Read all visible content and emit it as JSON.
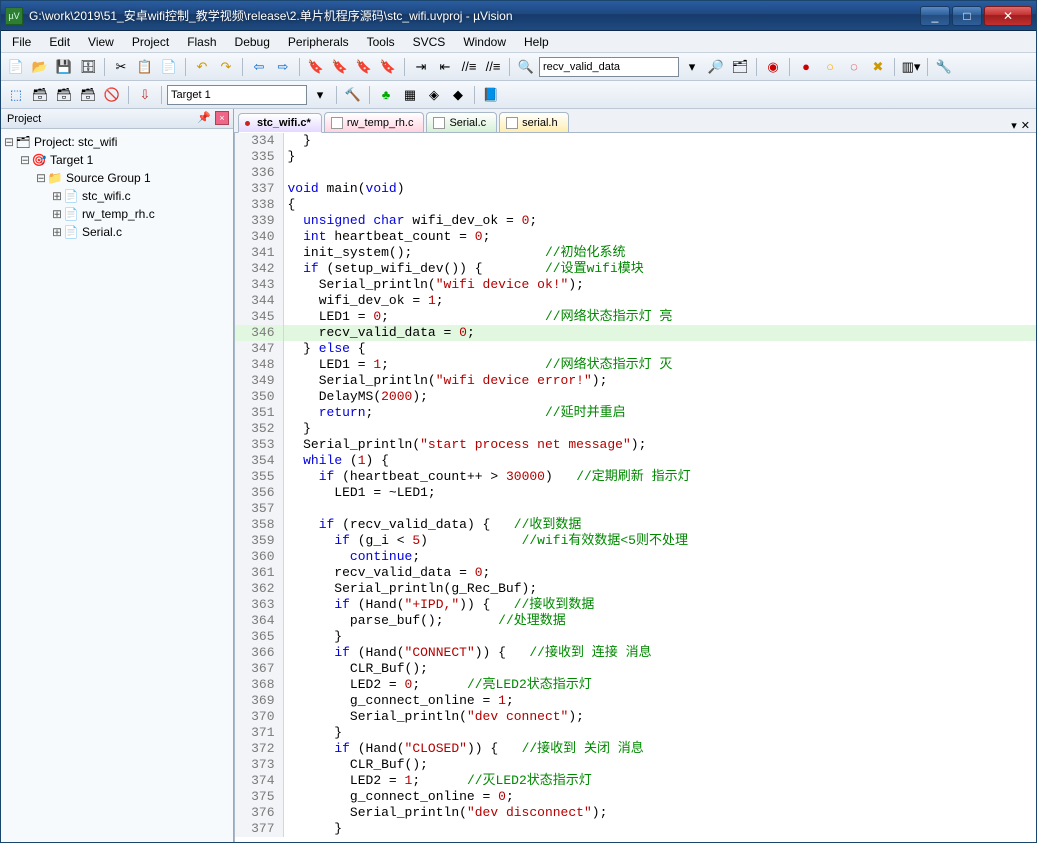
{
  "window": {
    "title": "G:\\work\\2019\\51_安卓wifi控制_教学视频\\release\\2.单片机程序源码\\stc_wifi.uvproj - µVision",
    "app_icon_label": "µV"
  },
  "menus": [
    "File",
    "Edit",
    "View",
    "Project",
    "Flash",
    "Debug",
    "Peripherals",
    "Tools",
    "SVCS",
    "Window",
    "Help"
  ],
  "toolbar1": {
    "search_value": "recv_valid_data"
  },
  "toolbar2": {
    "target_value": "Target 1"
  },
  "project_pane": {
    "title": "Project",
    "root_label": "Project: stc_wifi",
    "target_label": "Target 1",
    "group_label": "Source Group 1",
    "files": [
      "stc_wifi.c",
      "rw_temp_rh.c",
      "Serial.c"
    ]
  },
  "tabs": [
    {
      "label": "stc_wifi.c*",
      "cls": "lav"
    },
    {
      "label": "rw_temp_rh.c",
      "cls": "pink"
    },
    {
      "label": "Serial.c",
      "cls": "green"
    },
    {
      "label": "serial.h",
      "cls": "yell"
    }
  ],
  "highlight_line": 346,
  "code": [
    {
      "n": 334,
      "t": [
        [
          "",
          "  }"
        ]
      ]
    },
    {
      "n": 335,
      "t": [
        [
          "",
          "}"
        ]
      ]
    },
    {
      "n": 336,
      "t": [
        [
          "",
          ""
        ]
      ]
    },
    {
      "n": 337,
      "t": [
        [
          "ty",
          "void"
        ],
        [
          "",
          " main("
        ],
        [
          "ty",
          "void"
        ],
        [
          "",
          ")"
        ]
      ]
    },
    {
      "n": 338,
      "t": [
        [
          "",
          "{"
        ]
      ]
    },
    {
      "n": 339,
      "t": [
        [
          "",
          "  "
        ],
        [
          "ty",
          "unsigned char"
        ],
        [
          "",
          " wifi_dev_ok = "
        ],
        [
          "num",
          "0"
        ],
        [
          "",
          ";"
        ]
      ]
    },
    {
      "n": 340,
      "t": [
        [
          "",
          "  "
        ],
        [
          "ty",
          "int"
        ],
        [
          "",
          " heartbeat_count = "
        ],
        [
          "num",
          "0"
        ],
        [
          "",
          ";"
        ]
      ]
    },
    {
      "n": 341,
      "t": [
        [
          "",
          "  init_system();                 "
        ],
        [
          "cm",
          "//初始化系统"
        ]
      ]
    },
    {
      "n": 342,
      "t": [
        [
          "",
          "  "
        ],
        [
          "kw",
          "if"
        ],
        [
          "",
          " (setup_wifi_dev()) {        "
        ],
        [
          "cm",
          "//设置wifi模块"
        ]
      ]
    },
    {
      "n": 343,
      "t": [
        [
          "",
          "    Serial_println("
        ],
        [
          "str",
          "\"wifi device ok!\""
        ],
        [
          "",
          ");"
        ]
      ]
    },
    {
      "n": 344,
      "t": [
        [
          "",
          "    wifi_dev_ok = "
        ],
        [
          "num",
          "1"
        ],
        [
          "",
          ";"
        ]
      ]
    },
    {
      "n": 345,
      "t": [
        [
          "",
          "    LED1 = "
        ],
        [
          "num",
          "0"
        ],
        [
          "",
          ";                    "
        ],
        [
          "cm",
          "//网络状态指示灯 亮"
        ]
      ]
    },
    {
      "n": 346,
      "t": [
        [
          "",
          "    recv_valid_data = "
        ],
        [
          "num",
          "0"
        ],
        [
          "",
          ";"
        ]
      ]
    },
    {
      "n": 347,
      "t": [
        [
          "",
          "  } "
        ],
        [
          "kw",
          "else"
        ],
        [
          "",
          " {"
        ]
      ]
    },
    {
      "n": 348,
      "t": [
        [
          "",
          "    LED1 = "
        ],
        [
          "num",
          "1"
        ],
        [
          "",
          ";                    "
        ],
        [
          "cm",
          "//网络状态指示灯 灭"
        ]
      ]
    },
    {
      "n": 349,
      "t": [
        [
          "",
          "    Serial_println("
        ],
        [
          "str",
          "\"wifi device error!\""
        ],
        [
          "",
          ");"
        ]
      ]
    },
    {
      "n": 350,
      "t": [
        [
          "",
          "    DelayMS("
        ],
        [
          "num",
          "2000"
        ],
        [
          "",
          ");"
        ]
      ]
    },
    {
      "n": 351,
      "t": [
        [
          "",
          "    "
        ],
        [
          "kw",
          "return"
        ],
        [
          "",
          ";                      "
        ],
        [
          "cm",
          "//延时并重启"
        ]
      ]
    },
    {
      "n": 352,
      "t": [
        [
          "",
          "  }"
        ]
      ]
    },
    {
      "n": 353,
      "t": [
        [
          "",
          "  Serial_println("
        ],
        [
          "str",
          "\"start process net message\""
        ],
        [
          "",
          ");"
        ]
      ]
    },
    {
      "n": 354,
      "t": [
        [
          "",
          "  "
        ],
        [
          "kw",
          "while"
        ],
        [
          "",
          " ("
        ],
        [
          "num",
          "1"
        ],
        [
          "",
          ") {"
        ]
      ]
    },
    {
      "n": 355,
      "t": [
        [
          "",
          "    "
        ],
        [
          "kw",
          "if"
        ],
        [
          "",
          " (heartbeat_count++ > "
        ],
        [
          "num",
          "30000"
        ],
        [
          "",
          ")   "
        ],
        [
          "cm",
          "//定期刷新 指示灯"
        ]
      ]
    },
    {
      "n": 356,
      "t": [
        [
          "",
          "      LED1 = ~LED1;"
        ]
      ]
    },
    {
      "n": 357,
      "t": [
        [
          "",
          ""
        ]
      ]
    },
    {
      "n": 358,
      "t": [
        [
          "",
          "    "
        ],
        [
          "kw",
          "if"
        ],
        [
          "",
          " (recv_valid_data) {   "
        ],
        [
          "cm",
          "//收到数据"
        ]
      ]
    },
    {
      "n": 359,
      "t": [
        [
          "",
          "      "
        ],
        [
          "kw",
          "if"
        ],
        [
          "",
          " (g_i < "
        ],
        [
          "num",
          "5"
        ],
        [
          "",
          ")            "
        ],
        [
          "cm",
          "//wifi有效数据<5则不处理"
        ]
      ]
    },
    {
      "n": 360,
      "t": [
        [
          "",
          "        "
        ],
        [
          "kw",
          "continue"
        ],
        [
          "",
          ";"
        ]
      ]
    },
    {
      "n": 361,
      "t": [
        [
          "",
          "      recv_valid_data = "
        ],
        [
          "num",
          "0"
        ],
        [
          "",
          ";"
        ]
      ]
    },
    {
      "n": 362,
      "t": [
        [
          "",
          "      Serial_println(g_Rec_Buf);"
        ]
      ]
    },
    {
      "n": 363,
      "t": [
        [
          "",
          "      "
        ],
        [
          "kw",
          "if"
        ],
        [
          "",
          " (Hand("
        ],
        [
          "str",
          "\"+IPD,\""
        ],
        [
          "",
          ")) {   "
        ],
        [
          "cm",
          "//接收到数据"
        ]
      ]
    },
    {
      "n": 364,
      "t": [
        [
          "",
          "        parse_buf();       "
        ],
        [
          "cm",
          "//处理数据"
        ]
      ]
    },
    {
      "n": 365,
      "t": [
        [
          "",
          "      }"
        ]
      ]
    },
    {
      "n": 366,
      "t": [
        [
          "",
          "      "
        ],
        [
          "kw",
          "if"
        ],
        [
          "",
          " (Hand("
        ],
        [
          "str",
          "\"CONNECT\""
        ],
        [
          "",
          ")) {   "
        ],
        [
          "cm",
          "//接收到 连接 消息"
        ]
      ]
    },
    {
      "n": 367,
      "t": [
        [
          "",
          "        CLR_Buf();"
        ]
      ]
    },
    {
      "n": 368,
      "t": [
        [
          "",
          "        LED2 = "
        ],
        [
          "num",
          "0"
        ],
        [
          "",
          ";      "
        ],
        [
          "cm",
          "//亮LED2状态指示灯"
        ]
      ]
    },
    {
      "n": 369,
      "t": [
        [
          "",
          "        g_connect_online = "
        ],
        [
          "num",
          "1"
        ],
        [
          "",
          ";"
        ]
      ]
    },
    {
      "n": 370,
      "t": [
        [
          "",
          "        Serial_println("
        ],
        [
          "str",
          "\"dev connect\""
        ],
        [
          "",
          ");"
        ]
      ]
    },
    {
      "n": 371,
      "t": [
        [
          "",
          "      }"
        ]
      ]
    },
    {
      "n": 372,
      "t": [
        [
          "",
          "      "
        ],
        [
          "kw",
          "if"
        ],
        [
          "",
          " (Hand("
        ],
        [
          "str",
          "\"CLOSED\""
        ],
        [
          "",
          ")) {   "
        ],
        [
          "cm",
          "//接收到 关闭 消息"
        ]
      ]
    },
    {
      "n": 373,
      "t": [
        [
          "",
          "        CLR_Buf();"
        ]
      ]
    },
    {
      "n": 374,
      "t": [
        [
          "",
          "        LED2 = "
        ],
        [
          "num",
          "1"
        ],
        [
          "",
          ";      "
        ],
        [
          "cm",
          "//灭LED2状态指示灯"
        ]
      ]
    },
    {
      "n": 375,
      "t": [
        [
          "",
          "        g_connect_online = "
        ],
        [
          "num",
          "0"
        ],
        [
          "",
          ";"
        ]
      ]
    },
    {
      "n": 376,
      "t": [
        [
          "",
          "        Serial_println("
        ],
        [
          "str",
          "\"dev disconnect\""
        ],
        [
          "",
          ");"
        ]
      ]
    },
    {
      "n": 377,
      "t": [
        [
          "",
          "      }"
        ]
      ]
    }
  ]
}
